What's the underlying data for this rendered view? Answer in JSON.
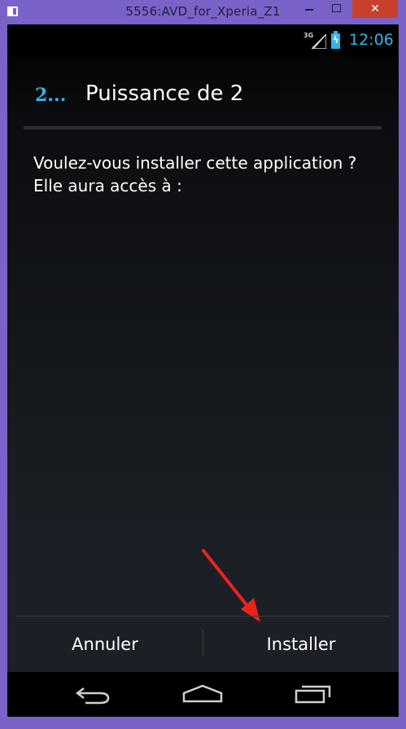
{
  "window": {
    "title": "5556:AVD_for_Xperia_Z1",
    "close_label": "✕"
  },
  "statusbar": {
    "network": "3G",
    "time": "12:06"
  },
  "dialog": {
    "app_icon_text": "2...",
    "title": "Puissance de 2",
    "message": "Voulez-vous installer cette application ? Elle aura accès à :"
  },
  "buttons": {
    "cancel": "Annuler",
    "install": "Installer"
  },
  "colors": {
    "accent": "#33b5e5",
    "window_frame": "#7a62c9",
    "close": "#c8402d",
    "annotation_arrow": "#e8241c"
  },
  "icons": {
    "back": "back-icon",
    "home": "home-icon",
    "recent": "recent-apps-icon"
  }
}
